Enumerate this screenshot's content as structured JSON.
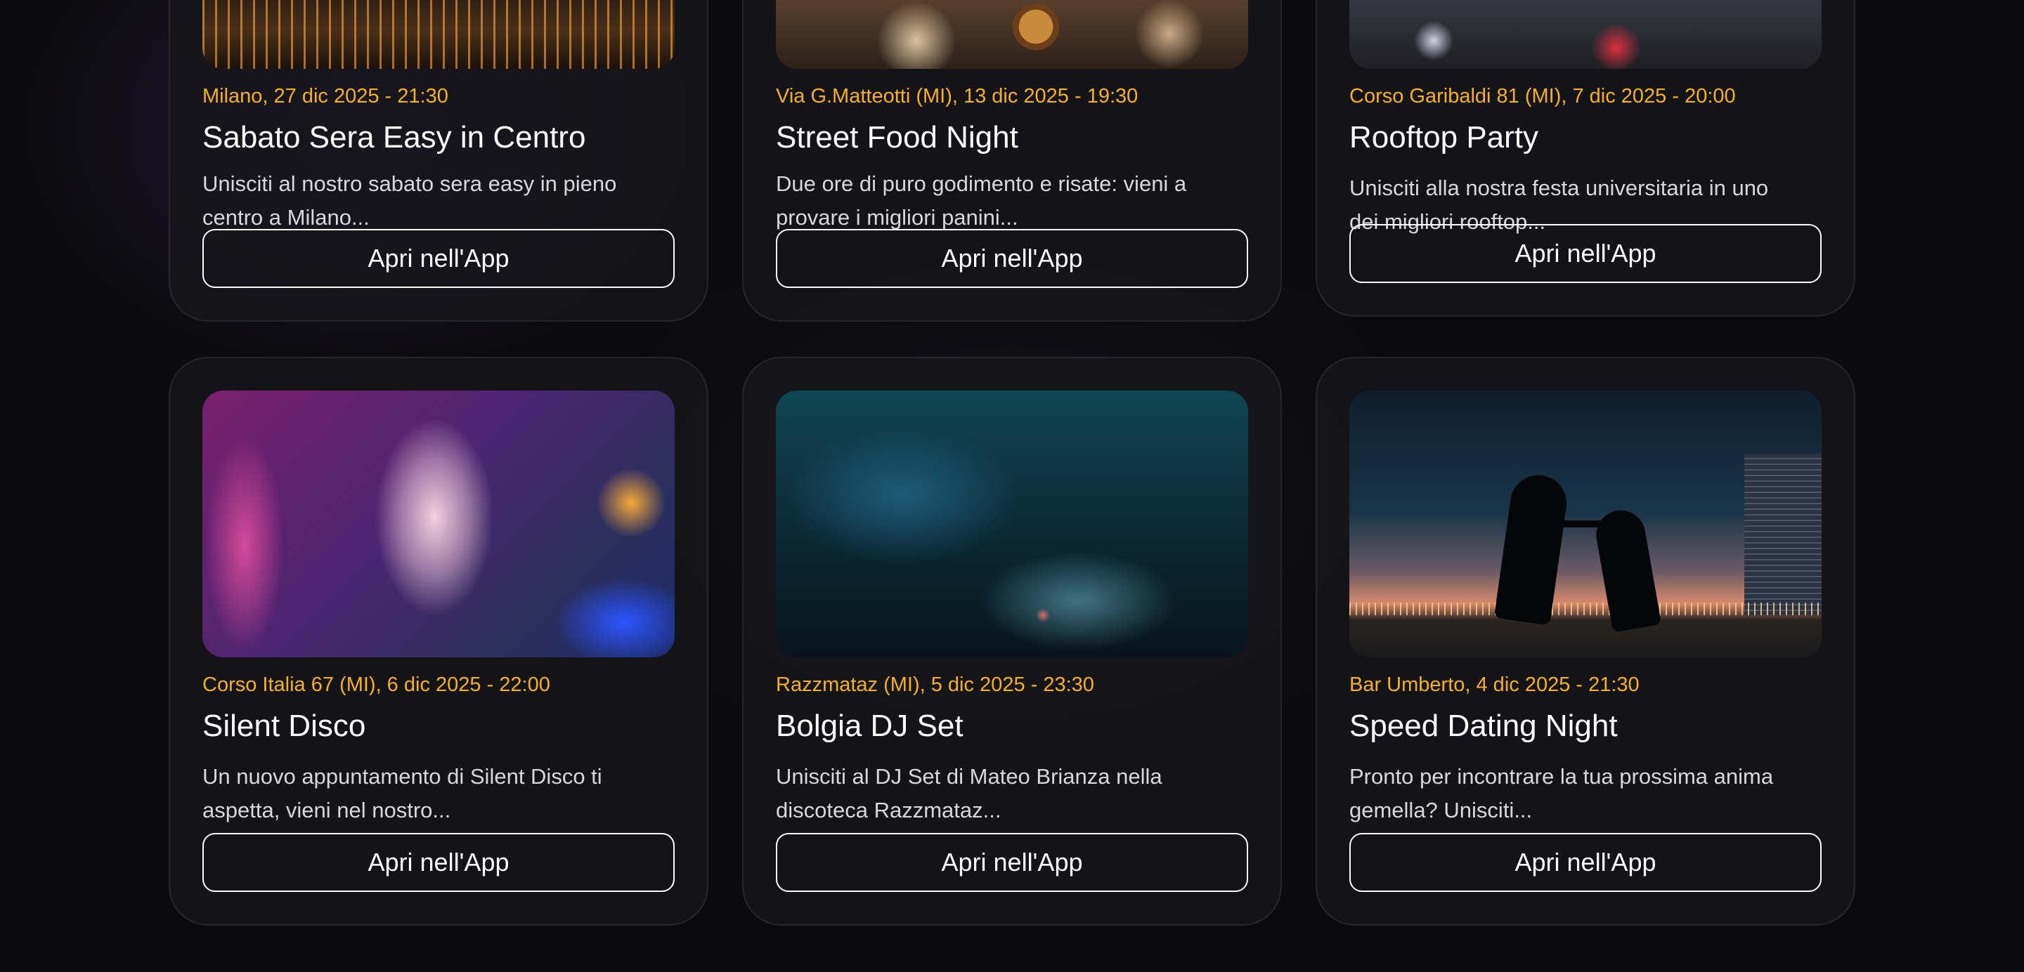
{
  "events": [
    {
      "meta": "Milano, 27 dic 2025 - 21:30",
      "title": "Sabato Sera Easy in Centro",
      "description": "Unisciti al nostro sabato sera easy in pieno centro a Milano...",
      "button": "Apri nell'App",
      "image": "milano-night-street-photo"
    },
    {
      "meta": "Via G.Matteotti (MI), 13 dic 2025 - 19:30",
      "title": "Street Food Night",
      "description": "Due ore di puro godimento e risate: vieni a provare i migliori panini...",
      "button": "Apri nell'App",
      "image": "street-food-photo"
    },
    {
      "meta": "Corso Garibaldi 81 (MI), 7 dic 2025 - 20:00",
      "title": "Rooftop Party",
      "description": "Unisciti alla nostra festa universitaria in uno dei migliori rooftop...",
      "button": "Apri nell'App",
      "image": "rooftop-party-photo"
    },
    {
      "meta": "Corso Italia 67 (MI), 6 dic 2025 - 22:00",
      "title": "Silent Disco",
      "description": "Un nuovo appuntamento di Silent Disco ti aspetta, vieni nel nostro...",
      "button": "Apri nell'App",
      "image": "silent-disco-photo"
    },
    {
      "meta": "Razzmataz (MI), 5 dic 2025 - 23:30",
      "title": "Bolgia DJ Set",
      "description": "Unisciti al DJ Set di Mateo Brianza nella discoteca Razzmataz...",
      "button": "Apri nell'App",
      "image": "dj-set-photo"
    },
    {
      "meta": "Bar Umberto, 4 dic 2025 - 21:30",
      "title": "Speed Dating Night",
      "description": "Pronto per incontrare la tua prossima anima gemella? Unisciti...",
      "button": "Apri nell'App",
      "image": "speed-dating-photo"
    }
  ],
  "colors": {
    "background": "#0b0b0d",
    "card": "#16161a",
    "meta": "#f6b21b",
    "text": "#ffffff",
    "description": "#d7d7dc"
  }
}
